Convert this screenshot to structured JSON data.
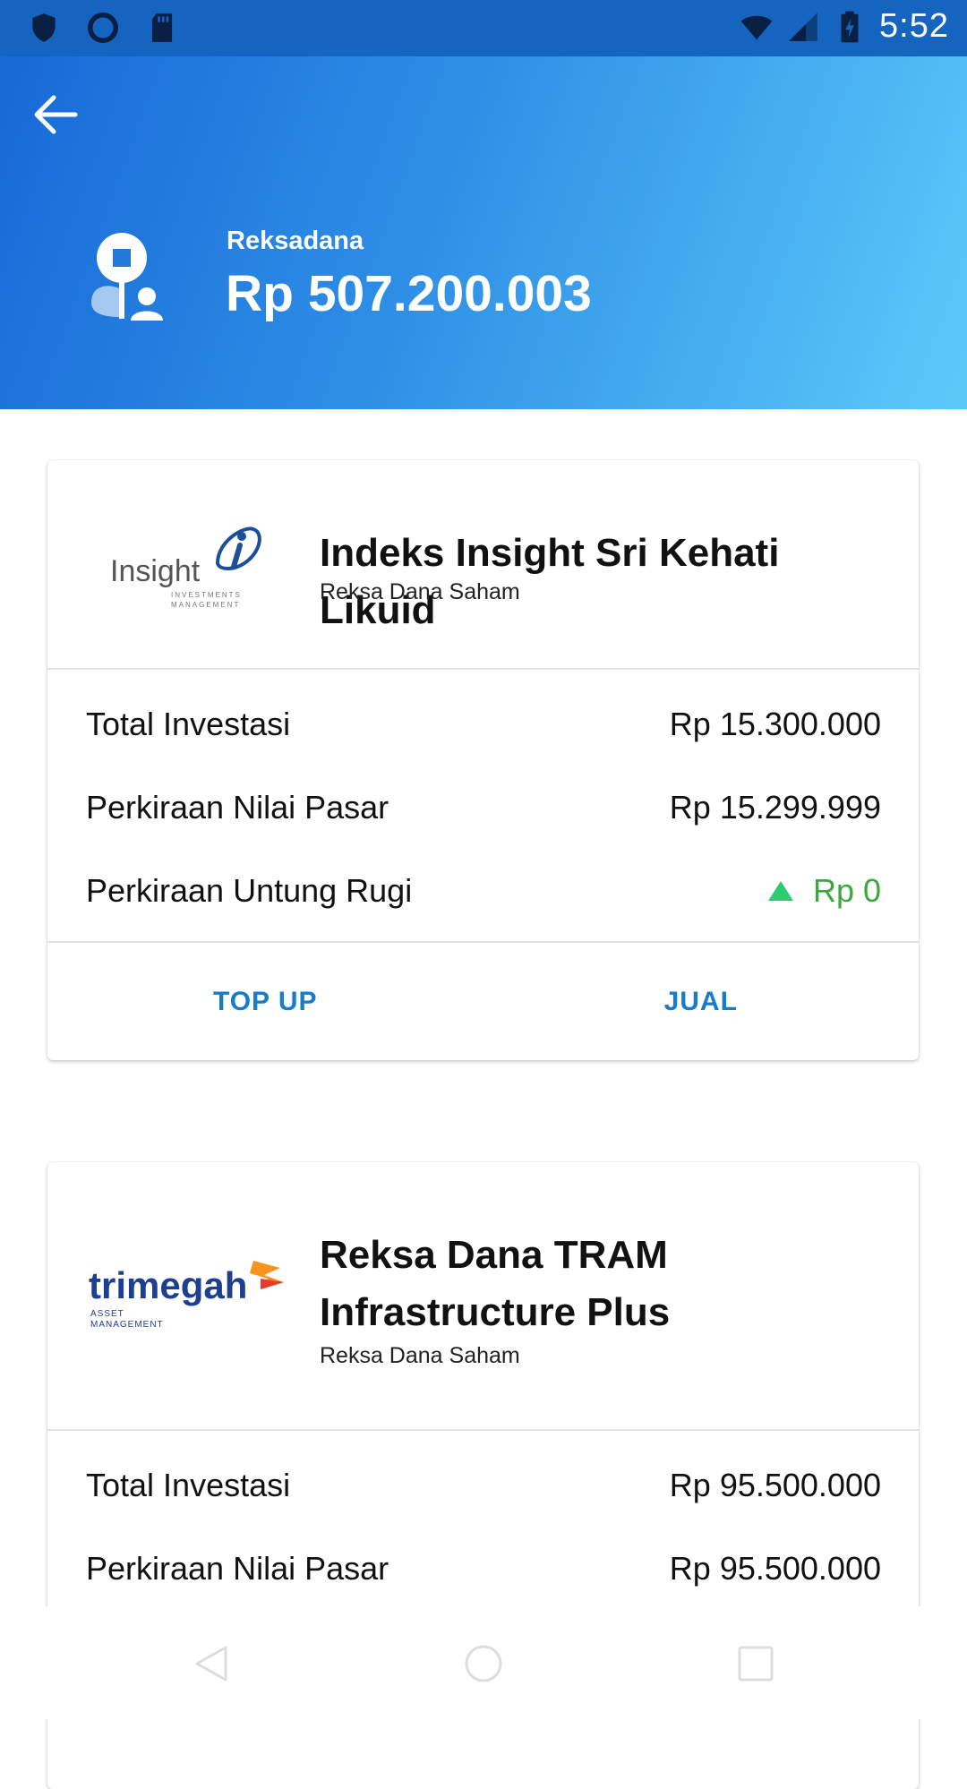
{
  "status_bar": {
    "time": "5:52",
    "icons": [
      "shield-icon",
      "circle-icon",
      "sd-card-icon",
      "wifi-icon",
      "signal-icon",
      "battery-charging-icon"
    ]
  },
  "header": {
    "back_icon": "arrow-left-icon",
    "label": "Reksadana",
    "total_amount": "Rp 507.200.003"
  },
  "funds": [
    {
      "logo_text": "Insight",
      "logo_subtext": "INVESTMENTS MANAGEMENT",
      "name": "Indeks Insight Sri Kehati Likuid",
      "type": "Reksa Dana Saham",
      "rows": [
        {
          "label": "Total Investasi",
          "value": "Rp 15.300.000"
        },
        {
          "label": "Perkiraan Nilai Pasar",
          "value": "Rp 15.299.999"
        },
        {
          "label": "Perkiraan Untung Rugi",
          "value": "Rp 0"
        }
      ],
      "actions": [
        "TOP UP",
        "JUAL"
      ]
    },
    {
      "logo_text": "trimegah",
      "logo_subtext": "ASSET MANAGEMENT",
      "name": "Reksa Dana TRAM Infrastructure Plus",
      "type": "Reksa Dana Saham",
      "rows": [
        {
          "label": "Total Investasi",
          "value": "Rp 95.500.000"
        },
        {
          "label": "Perkiraan Nilai Pasar",
          "value": "Rp 95.500.000"
        }
      ]
    }
  ],
  "colors": {
    "header_start": "#1769d6",
    "header_end": "#5ccaf9",
    "action": "#1a7bc8",
    "gain": "#3aa83e",
    "gain_arrow": "#2ecc71"
  },
  "nav_bar": [
    "back-nav-icon",
    "home-nav-icon",
    "recents-nav-icon"
  ]
}
